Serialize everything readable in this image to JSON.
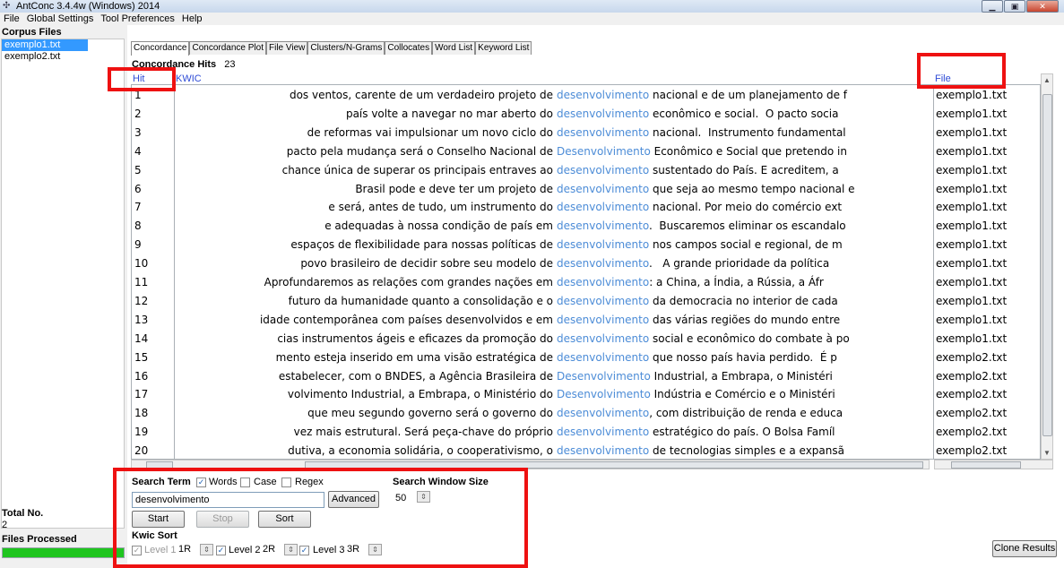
{
  "window": {
    "title": "AntConc 3.4.4w (Windows) 2014",
    "icon": "antconc-app-icon",
    "controls": [
      "minimize-icon",
      "maximize-icon",
      "close-icon"
    ]
  },
  "menu": [
    "File",
    "Global Settings",
    "Tool Preferences",
    "Help"
  ],
  "sidebar": {
    "title": "Corpus Files",
    "files": [
      "exemplo1.txt",
      "exemplo2.txt"
    ],
    "total_label": "Total No.",
    "total_value": "2",
    "files_processed_label": "Files Processed",
    "progress_percent": 100,
    "progress_color": "#1fc51f"
  },
  "tabs": [
    "Concordance",
    "Concordance Plot",
    "File View",
    "Clusters/N-Grams",
    "Collocates",
    "Word List",
    "Keyword List"
  ],
  "concordance": {
    "hits_label": "Concordance Hits",
    "hits_count": "23",
    "col_hit": "Hit",
    "col_kwic": "KWIC",
    "col_file": "File",
    "keyword_color": "#4c8cd7",
    "rows": [
      {
        "hit": "1",
        "left": "dos ventos, carente de um verdadeiro projeto de",
        "kw": "desenvolvimento",
        "right": " nacional e de um planejamento de f",
        "file": "exemplo1.txt"
      },
      {
        "hit": "2",
        "left": "país volte a navegar no mar aberto do",
        "kw": "desenvolvimento",
        "right": " econômico e social.  O pacto socia",
        "file": "exemplo1.txt"
      },
      {
        "hit": "3",
        "left": "de reformas vai impulsionar um novo ciclo do",
        "kw": "desenvolvimento",
        "right": " nacional.  Instrumento fundamental",
        "file": "exemplo1.txt"
      },
      {
        "hit": "4",
        "left": "pacto pela mudança será o Conselho Nacional de",
        "kw": "Desenvolvimento",
        "right": " Econômico e Social que pretendo in",
        "file": "exemplo1.txt"
      },
      {
        "hit": "5",
        "left": "chance única de superar os principais entraves ao",
        "kw": "desenvolvimento",
        "right": " sustentado do País. E acreditem, a",
        "file": "exemplo1.txt"
      },
      {
        "hit": "6",
        "left": "Brasil pode e deve ter um projeto de",
        "kw": "desenvolvimento",
        "right": " que seja ao mesmo tempo nacional e",
        "file": "exemplo1.txt"
      },
      {
        "hit": "7",
        "left": "e será, antes de tudo, um instrumento do",
        "kw": "desenvolvimento",
        "right": " nacional. Por meio do comércio ext",
        "file": "exemplo1.txt"
      },
      {
        "hit": "8",
        "left": "e adequadas à nossa condição de país em",
        "kw": "desenvolvimento",
        "right": ".  Buscaremos eliminar os escandalo",
        "file": "exemplo1.txt"
      },
      {
        "hit": "9",
        "left": "espaços de flexibilidade para nossas políticas de",
        "kw": "desenvolvimento",
        "right": " nos campos social e regional, de m",
        "file": "exemplo1.txt"
      },
      {
        "hit": "10",
        "left": "povo brasileiro de decidir sobre seu modelo de",
        "kw": "desenvolvimento",
        "right": ".   A grande prioridade da política",
        "file": "exemplo1.txt"
      },
      {
        "hit": "11",
        "left": "Aprofundaremos as relações com grandes nações em",
        "kw": "desenvolvimento",
        "right": ": a China, a Índia, a Rússia, a Áfr",
        "file": "exemplo1.txt"
      },
      {
        "hit": "12",
        "left": "futuro da humanidade quanto a consolidação e o",
        "kw": "desenvolvimento",
        "right": " da democracia no interior de cada",
        "file": "exemplo1.txt"
      },
      {
        "hit": "13",
        "left": "idade contemporânea com países desenvolvidos e em",
        "kw": "desenvolvimento",
        "right": " das várias regiões do mundo entre",
        "file": "exemplo1.txt"
      },
      {
        "hit": "14",
        "left": "cias instrumentos ágeis e eficazes da promoção do",
        "kw": "desenvolvimento",
        "right": " social e econômico do combate à po",
        "file": "exemplo1.txt"
      },
      {
        "hit": "15",
        "left": "mento esteja inserido em uma visão estratégica de",
        "kw": "desenvolvimento",
        "right": " que nosso país havia perdido.  É p",
        "file": "exemplo2.txt"
      },
      {
        "hit": "16",
        "left": "estabelecer, com o BNDES, a Agência Brasileira de",
        "kw": "Desenvolvimento",
        "right": " Industrial, a Embrapa, o Ministéri",
        "file": "exemplo2.txt"
      },
      {
        "hit": "17",
        "left": "volvimento Industrial, a Embrapa, o Ministério do",
        "kw": "Desenvolvimento",
        "right": " Indústria e Comércio e o Ministéri",
        "file": "exemplo2.txt"
      },
      {
        "hit": "18",
        "left": "que meu segundo governo será o governo do",
        "kw": "desenvolvimento",
        "right": ", com distribuição de renda e educa",
        "file": "exemplo2.txt"
      },
      {
        "hit": "19",
        "left": "vez mais estrutural.  Será peça-chave do próprio",
        "kw": "desenvolvimento",
        "right": " estratégico do país. O Bolsa Famíl",
        "file": "exemplo2.txt"
      },
      {
        "hit": "20",
        "left": "dutiva, a economia solidária, o cooperativismo, o",
        "kw": "desenvolvimento",
        "right": " de tecnologias simples e a expansã",
        "file": "exemplo2.txt"
      }
    ]
  },
  "search": {
    "term_label": "Search Term",
    "words_label": "Words",
    "words_checked": true,
    "case_label": "Case",
    "case_checked": false,
    "regex_label": "Regex",
    "regex_checked": false,
    "value": "desenvolvimento",
    "advanced_label": "Advanced",
    "window_size_label": "Search Window Size",
    "window_size_value": "50",
    "start_label": "Start",
    "stop_label": "Stop",
    "sort_label": "Sort"
  },
  "kwic_sort": {
    "title": "Kwic Sort",
    "levels": [
      {
        "label": "Level 1",
        "value": "1R",
        "enabled": false,
        "checked": true
      },
      {
        "label": "Level 2",
        "value": "2R",
        "enabled": true,
        "checked": true
      },
      {
        "label": "Level 3",
        "value": "3R",
        "enabled": true,
        "checked": true
      }
    ]
  },
  "clone_results_label": "Clone Results",
  "highlight_color": "#ee1111"
}
